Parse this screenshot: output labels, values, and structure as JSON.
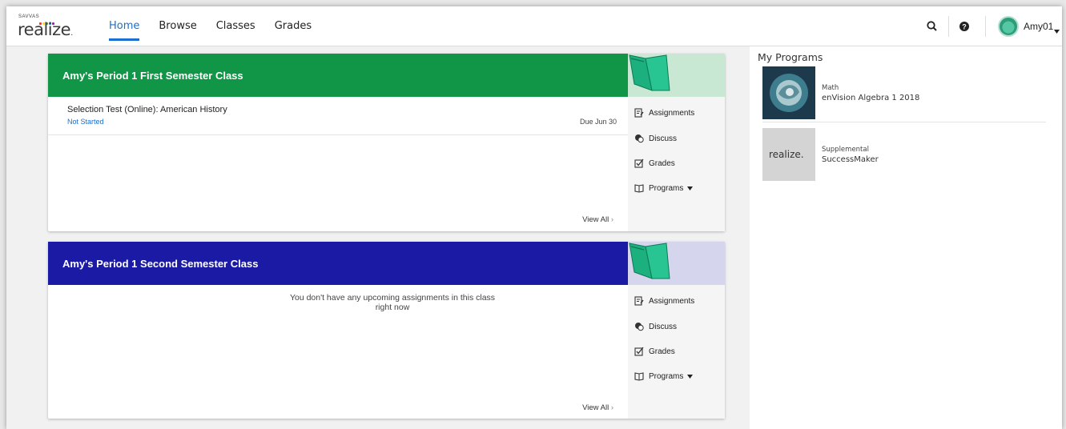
{
  "header": {
    "logo_brand": "SAVVAS",
    "logo_word": "realize",
    "logo_dot": ".",
    "nav": [
      {
        "label": "Home",
        "active": true
      },
      {
        "label": "Browse",
        "active": false
      },
      {
        "label": "Classes",
        "active": false
      },
      {
        "label": "Grades",
        "active": false
      }
    ],
    "icons": [
      "search-icon",
      "help-icon",
      "avatar",
      "caret-down-icon"
    ],
    "user": "Amy01"
  },
  "colors": {
    "accent": "#1a6fd0",
    "class1_banner": "#109646",
    "class1_art_bg": "#c9e8d4",
    "class2_banner": "#1a1aa4",
    "class2_art_bg": "#d5d5ee"
  },
  "classes": [
    {
      "title": "Amy's Period 1 First Semester Class",
      "assignment": {
        "title": "Selection Test (Online): American History",
        "status": "Not Started",
        "due": "Due Jun 30"
      },
      "side": {
        "assignments": "Assignments",
        "discuss": "Discuss",
        "grades": "Grades",
        "programs": "Programs"
      },
      "view_all": "View All"
    },
    {
      "title": "Amy's Period 1 Second Semester Class",
      "empty_message": "You don't have any upcoming assignments in this class right now",
      "side": {
        "assignments": "Assignments",
        "discuss": "Discuss",
        "grades": "Grades",
        "programs": "Programs"
      },
      "view_all": "View All"
    }
  ],
  "programs": {
    "title": "My Programs",
    "items": [
      {
        "category": "Math",
        "name": "enVision Algebra 1 2018"
      },
      {
        "category": "Supplemental",
        "name": "SuccessMaker",
        "thumb_text": "realize."
      }
    ]
  }
}
